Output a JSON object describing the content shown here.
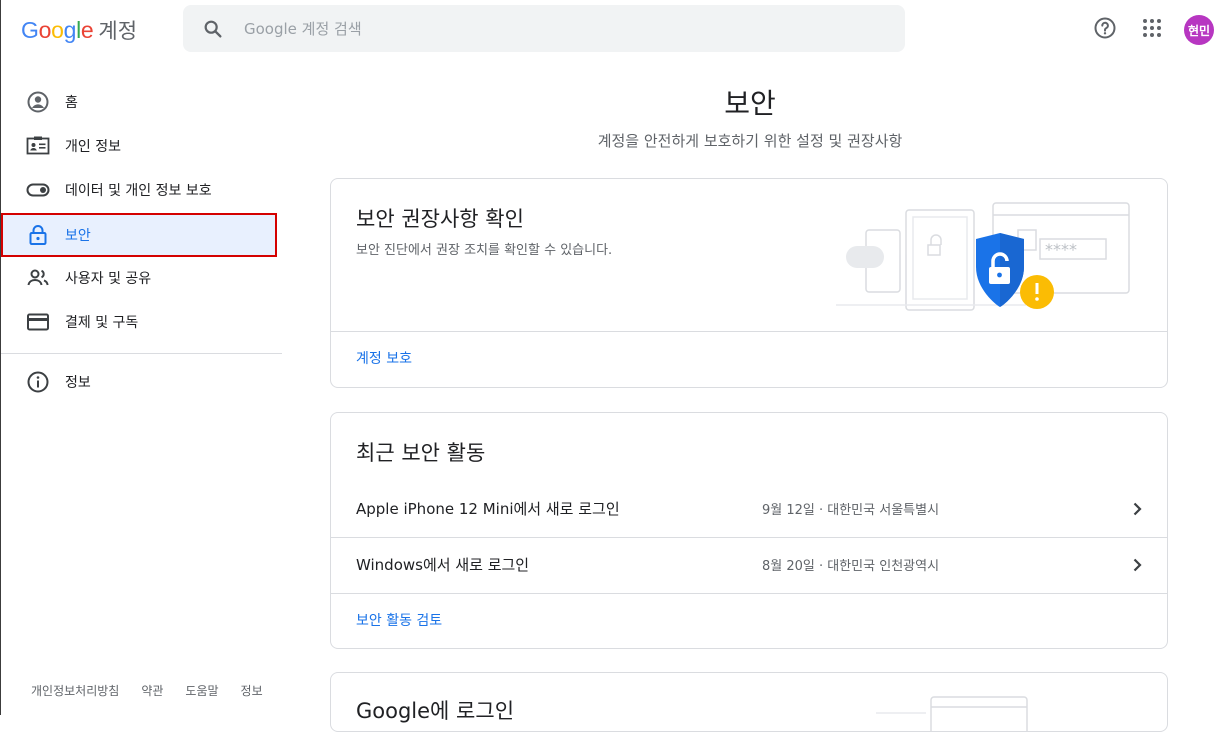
{
  "header": {
    "logo_letters": [
      "G",
      "o",
      "o",
      "g",
      "l",
      "e"
    ],
    "logo_colors": [
      "#4285f4",
      "#ea4335",
      "#fbbc05",
      "#4285f4",
      "#34a853",
      "#ea4335"
    ],
    "logo_suffix": "계정",
    "search_placeholder": "Google 계정 검색",
    "avatar_text": "현민",
    "avatar_color": "#b736c1"
  },
  "sidebar": {
    "items": [
      {
        "label": "홈",
        "icon": "account-circle-icon"
      },
      {
        "label": "개인 정보",
        "icon": "id-card-icon"
      },
      {
        "label": "데이터 및 개인 정보 보호",
        "icon": "toggle-icon"
      },
      {
        "label": "보안",
        "icon": "lock-icon",
        "active": true
      },
      {
        "label": "사용자 및 공유",
        "icon": "people-icon"
      },
      {
        "label": "결제 및 구독",
        "icon": "credit-card-icon"
      }
    ],
    "info_item": {
      "label": "정보",
      "icon": "info-icon"
    },
    "footer": [
      "개인정보처리방침",
      "약관",
      "도움말",
      "정보"
    ]
  },
  "main": {
    "title": "보안",
    "subtitle": "계정을 안전하게 보호하기 위한 설정 및 권장사항",
    "recommend_card": {
      "title": "보안 권장사항 확인",
      "desc": "보안 진단에서 권장 조치를 확인할 수 있습니다.",
      "link": "계정 보호",
      "password_mask": "****"
    },
    "activity_card": {
      "title": "최근 보안 활동",
      "rows": [
        {
          "title": "Apple iPhone 12 Mini에서 새로 로그인",
          "meta": "9월 12일 · 대한민국 서울특별시"
        },
        {
          "title": "Windows에서 새로 로그인",
          "meta": "8월 20일 · 대한민국 인천광역시"
        }
      ],
      "link": "보안 활동 검토"
    },
    "signin_card": {
      "title": "Google에 로그인"
    }
  },
  "colors": {
    "accent": "#1a73e8",
    "active_bg": "#e8f0fe",
    "highlight_border": "#d40000",
    "shield": "#1a73e8",
    "warning": "#fbbc04"
  }
}
